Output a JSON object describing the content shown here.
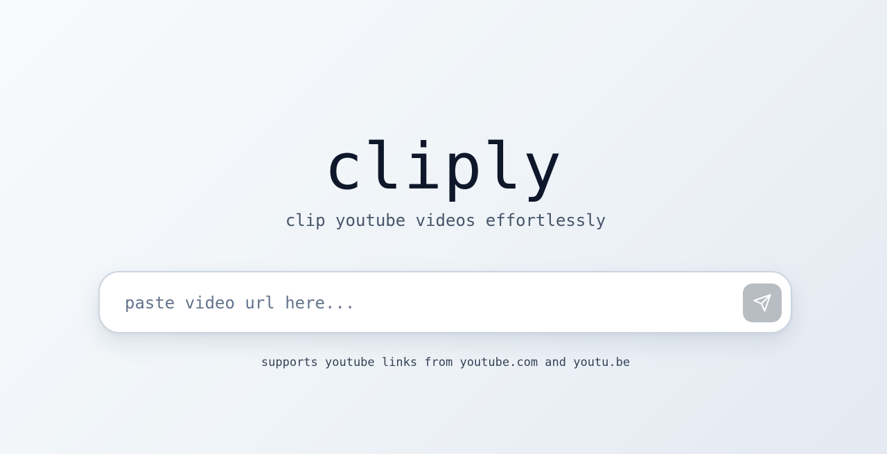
{
  "brand": {
    "title": "cliply",
    "tagline": "clip youtube videos effortlessly"
  },
  "url_form": {
    "value": "",
    "placeholder": "paste video url here...",
    "submit_icon": "send-icon",
    "submit_label": "Submit"
  },
  "hint": "supports youtube links from youtube.com and youtu.be",
  "colors": {
    "title": "#0f172a",
    "tagline": "#475569",
    "placeholder": "#64748b",
    "input_border": "#cbd5e1",
    "submit_background": "#b8bcc3",
    "submit_icon": "#ffffff",
    "background_start": "#f8fafc",
    "background_end": "#e4e9f2"
  }
}
